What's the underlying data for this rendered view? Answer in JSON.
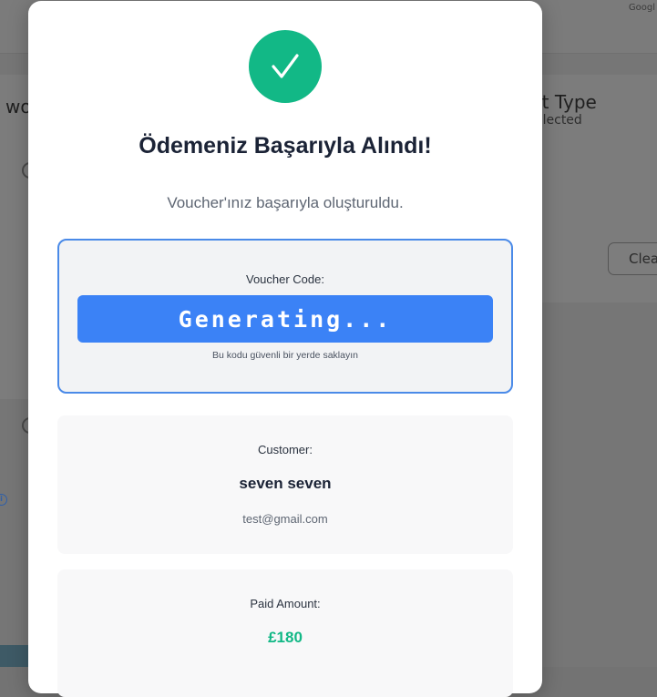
{
  "background": {
    "google_text": "Googl",
    "left_heading_fragment": "wo",
    "right_heading_fragment": "ht Type",
    "right_subtext_fragment": "elected",
    "clear_button_fragment": "Clea"
  },
  "modal": {
    "icon": "checkmark-icon",
    "title": "Ödemeniz Başarıyla Alındı!",
    "subtitle": "Voucher'ınız başarıyla oluşturuldu.",
    "voucher": {
      "label": "Voucher Code:",
      "code": "Generating...",
      "hint": "Bu kodu güvenli bir yerde saklayın"
    },
    "customer": {
      "label": "Customer:",
      "name": "seven seven",
      "email": "test@gmail.com"
    },
    "payment": {
      "label": "Paid Amount:",
      "amount": "£180"
    }
  },
  "colors": {
    "success_green": "#12b886",
    "voucher_blue": "#3b82f6",
    "voucher_border": "#4a8ae8",
    "title_dark": "#1b2336"
  }
}
